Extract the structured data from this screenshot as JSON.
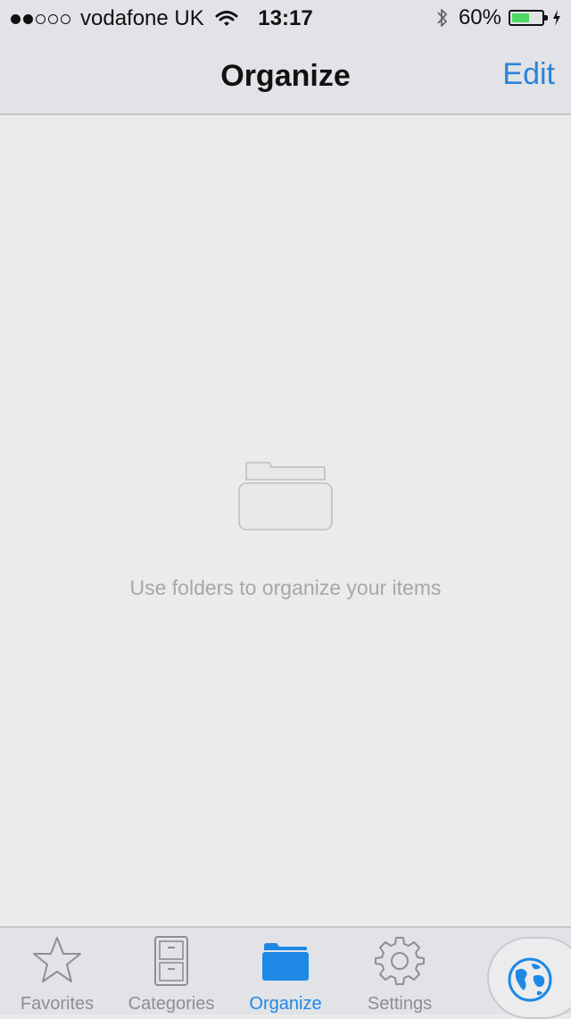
{
  "status_bar": {
    "carrier": "vodafone UK",
    "time": "13:17",
    "battery_percent": "60%",
    "battery_level": 0.6,
    "signal_full_dots": 2,
    "signal_total_dots": 5
  },
  "nav": {
    "title": "Organize",
    "edit_label": "Edit"
  },
  "empty_state": {
    "message": "Use folders to organize your items",
    "icon": "folder-icon"
  },
  "tabs": [
    {
      "label": "Favorites",
      "icon": "star-icon",
      "active": false
    },
    {
      "label": "Categories",
      "icon": "file-cabinet-icon",
      "active": false
    },
    {
      "label": "Organize",
      "icon": "folder-icon",
      "active": true
    },
    {
      "label": "Settings",
      "icon": "gear-icon",
      "active": false
    }
  ],
  "globe_button": {
    "icon": "globe-icon"
  },
  "colors": {
    "accent": "#1e88e5",
    "link": "#2a83d8",
    "inactive": "#8e8e93",
    "battery": "#4cd964",
    "background": "#ebebec",
    "bar": "#e1e3e7"
  }
}
